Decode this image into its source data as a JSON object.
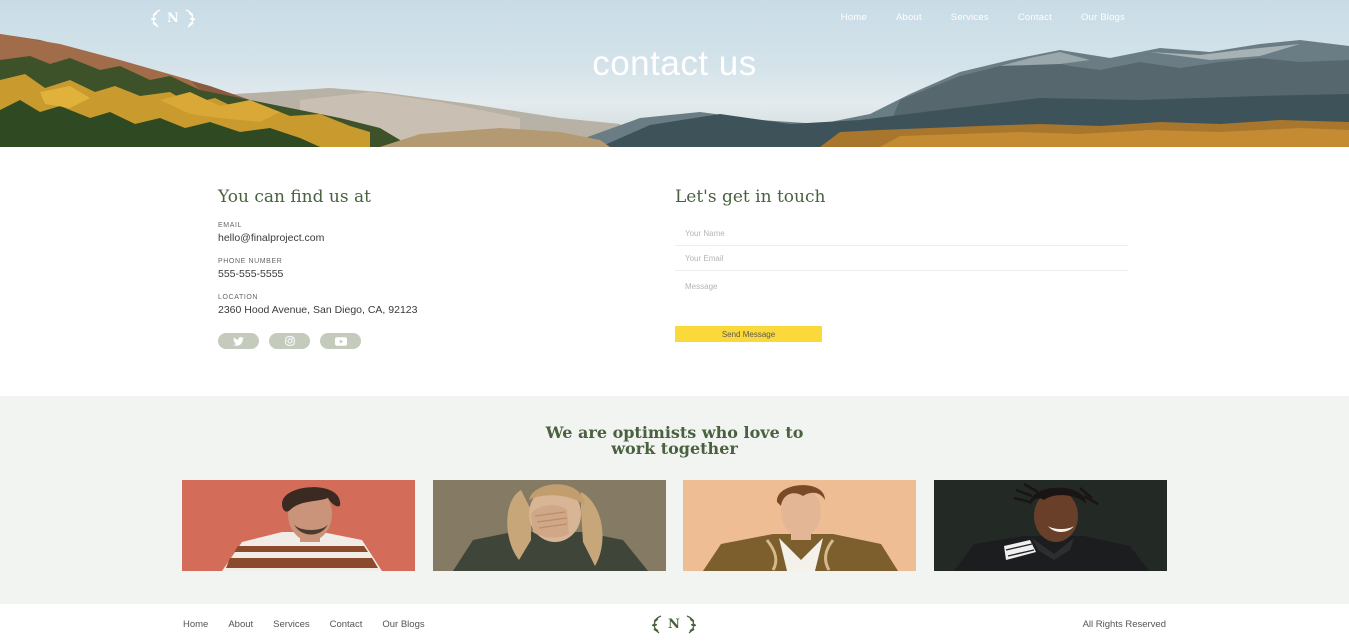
{
  "brand": {
    "logo_letter": "N"
  },
  "nav": {
    "items": [
      "Home",
      "About",
      "Services",
      "Contact",
      "Our Blogs"
    ]
  },
  "hero": {
    "title": "contact us"
  },
  "find_us": {
    "heading": "You can find us at",
    "email_label": "EMAIL",
    "email_value": "hello@finalproject.com",
    "phone_label": "PHONE NUMBER",
    "phone_value": "555-555-5555",
    "location_label": "LOCATION",
    "location_value": "2360 Hood Avenue, San Diego, CA, 92123",
    "socials": [
      "twitter-icon",
      "instagram-icon",
      "youtube-icon"
    ]
  },
  "contact_form": {
    "heading": "Let's get in touch",
    "name_placeholder": "Your Name",
    "email_placeholder": "Your Email",
    "message_placeholder": "Message",
    "send_label": "Send Message",
    "send_color": "#fbd93a"
  },
  "team": {
    "heading_line1": "We are optimists who love to",
    "heading_line2": "work together"
  },
  "footer": {
    "items": [
      "Home",
      "About",
      "Services",
      "Contact",
      "Our Blogs"
    ],
    "rights": "All Rights Reserved"
  },
  "colors": {
    "accent_green": "#4a6140",
    "social_bg": "#c4cbbd",
    "team_bg": "#f2f4f1"
  }
}
